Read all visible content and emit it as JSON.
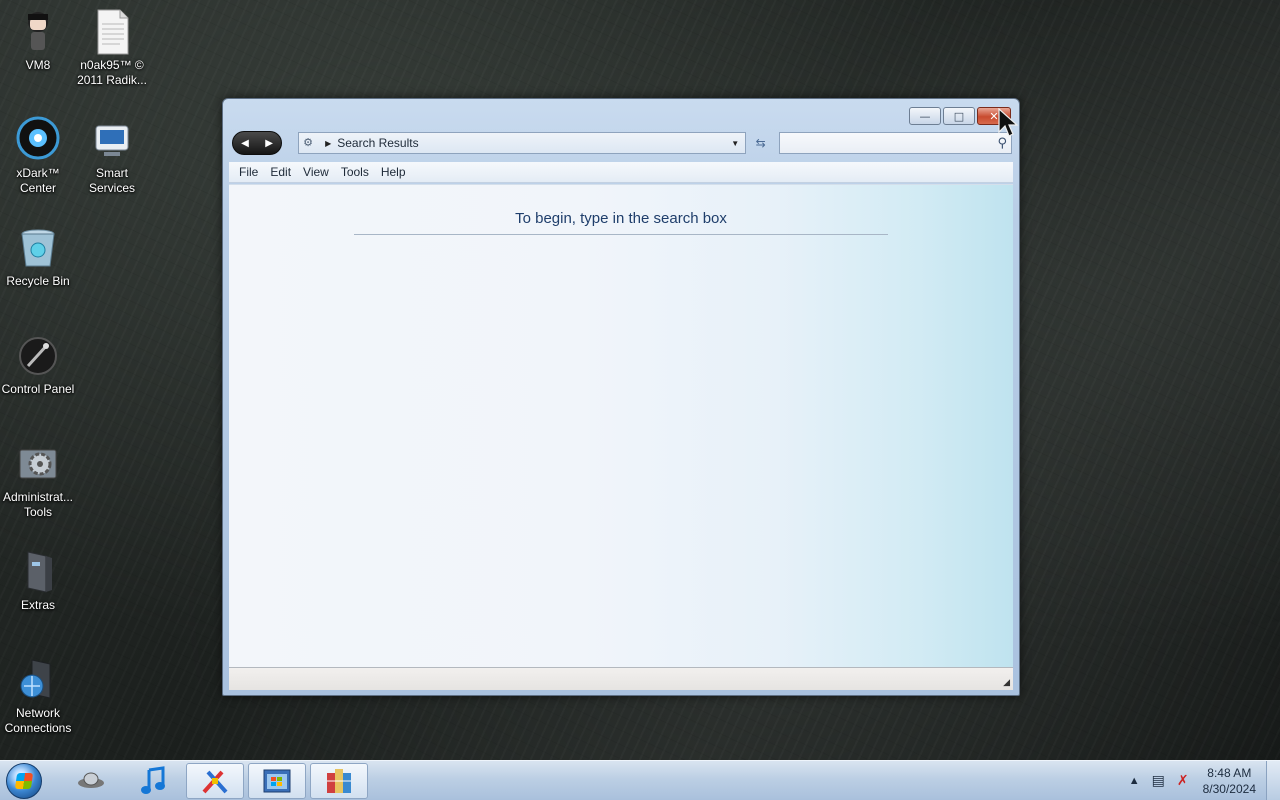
{
  "desktop": {
    "icons": [
      {
        "label": "VM8",
        "icon": "anime-character-icon"
      },
      {
        "label": "n0ak95™ © 2011 Radik...",
        "icon": "document-icon"
      },
      {
        "label": "xDark™ Center",
        "icon": "xdark-center-icon"
      },
      {
        "label": "Smart Services",
        "icon": "smart-services-icon"
      },
      {
        "label": "Recycle Bin",
        "icon": "recycle-bin-icon"
      },
      {
        "label": "Control Panel",
        "icon": "control-panel-icon"
      },
      {
        "label": "Administrat... Tools",
        "icon": "admin-tools-icon"
      },
      {
        "label": "Extras",
        "icon": "extras-icon"
      },
      {
        "label": "Network Connections",
        "icon": "network-connections-icon"
      }
    ]
  },
  "window": {
    "address_text": "Search Results",
    "menu": [
      "File",
      "Edit",
      "View",
      "Tools",
      "Help"
    ],
    "hint": "To begin, type in the search box",
    "search_placeholder": ""
  },
  "taskbar": {
    "pinned": [
      "media-player-icon",
      "music-icon",
      "paint-tool-icon",
      "explorer-window-icon",
      "archive-icon"
    ],
    "clock_time": "8:48 AM",
    "clock_date": "8/30/2024"
  },
  "colors": {
    "close_button": "#c84b2f",
    "hint_text": "#1f3e6b",
    "taskbar": "#bccfe4"
  }
}
